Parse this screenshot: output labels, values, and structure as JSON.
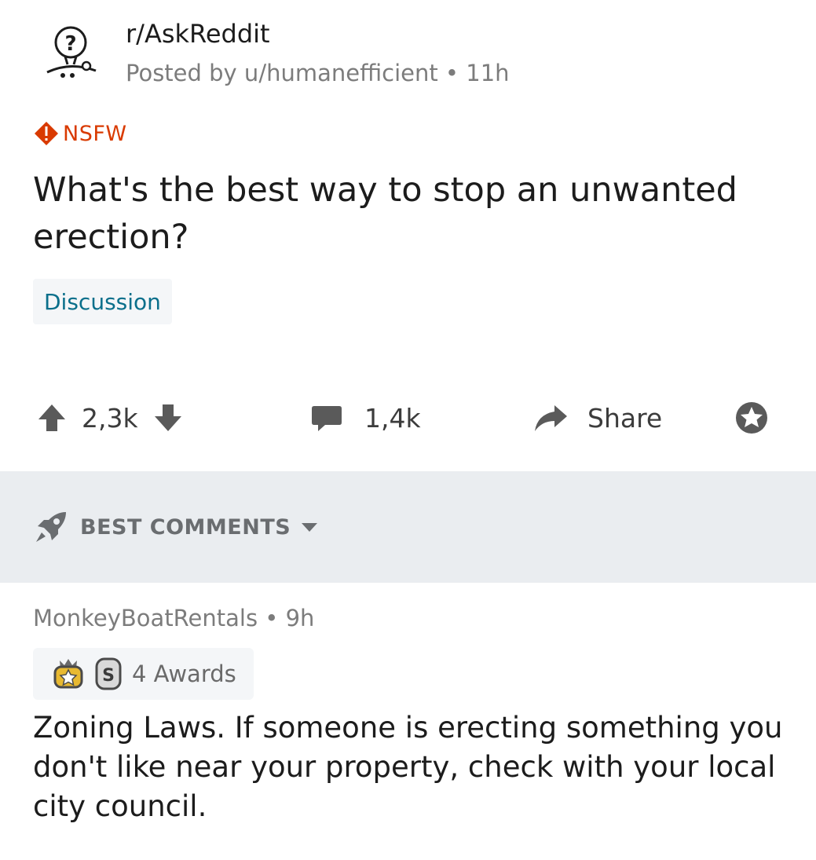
{
  "post": {
    "subreddit": "r/AskReddit",
    "posted_by": "Posted by u/humanefficient • 11h",
    "nsfw_label": "NSFW",
    "title": "What's the best way to stop an unwanted erection?",
    "flair": "Discussion",
    "upvotes": "2,3k",
    "comments": "1,4k",
    "share_label": "Share"
  },
  "sort": {
    "label": "BEST COMMENTS"
  },
  "comment": {
    "meta": "MonkeyBoatRentals • 9h",
    "awards_label": "4 Awards",
    "body": "Zoning Laws. If someone is erecting something you don't like near your property, check with your local city council."
  },
  "colors": {
    "nsfw": "#d93a00",
    "flair_text": "#0a6f8b",
    "sort_bar_bg": "#eaedf0",
    "muted_text": "#7c7c7c"
  },
  "icons": {
    "subreddit_avatar": "askreddit-snoo-icon",
    "nsfw": "nsfw-diamond-icon",
    "upvote": "upvote-arrow-icon",
    "downvote": "downvote-arrow-icon",
    "comments": "comment-bubble-icon",
    "share": "share-arrow-icon",
    "save": "star-icon",
    "sort": "rocket-icon",
    "award_gold": "gold-award-icon",
    "award_silver": "silver-award-icon"
  }
}
